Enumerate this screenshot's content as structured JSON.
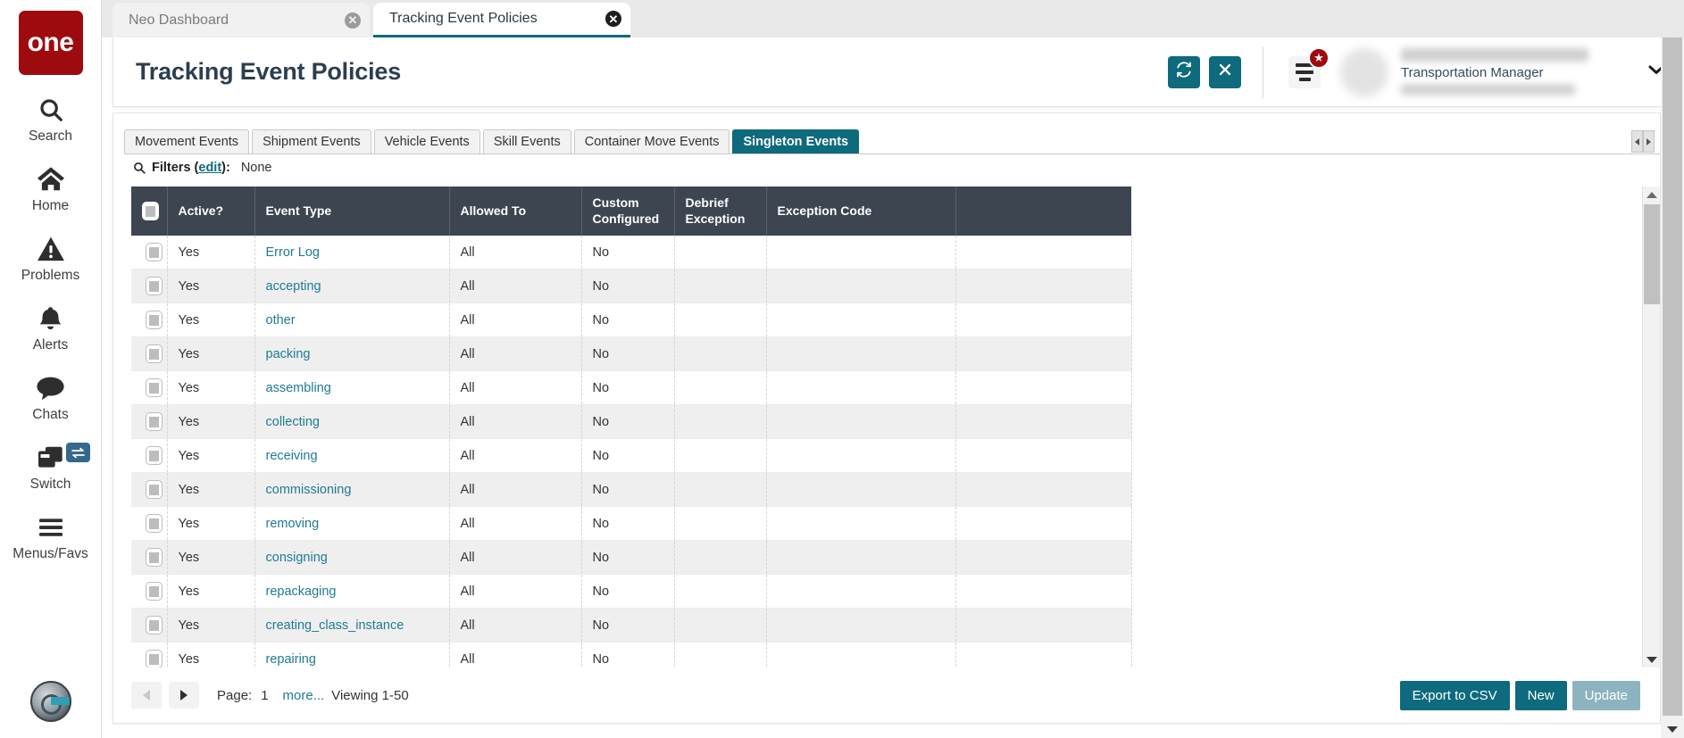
{
  "sidebar": {
    "logo_text": "one",
    "items": [
      {
        "label": "Search",
        "icon": "search-icon"
      },
      {
        "label": "Home",
        "icon": "home-icon"
      },
      {
        "label": "Problems",
        "icon": "warning-triangle-icon"
      },
      {
        "label": "Alerts",
        "icon": "bell-icon"
      },
      {
        "label": "Chats",
        "icon": "chat-bubble-icon"
      },
      {
        "label": "Switch",
        "icon": "windows-stack-icon"
      },
      {
        "label": "Menus/Favs",
        "icon": "hamburger-icon"
      }
    ],
    "switch_badge_icon": "swap-arrows-icon",
    "avatar_icon": "robot-head-avatar"
  },
  "browser_tabs": [
    {
      "label": "Neo Dashboard",
      "active": false,
      "close_icon": "close-circle-icon"
    },
    {
      "label": "Tracking Event Policies",
      "active": true,
      "close_icon": "close-circle-icon"
    }
  ],
  "header": {
    "title": "Tracking Event Policies",
    "refresh_icon": "refresh-icon",
    "close_icon": "x-icon",
    "menu_icon": "list-menu-icon",
    "star_badge_icon": "star-icon",
    "chevron_icon": "chevron-down-icon",
    "profile": {
      "role": "Transportation Manager",
      "name_redacted": true,
      "org_redacted": true
    }
  },
  "panel": {
    "tabs": [
      {
        "label": "Movement Events",
        "active": false
      },
      {
        "label": "Shipment Events",
        "active": false
      },
      {
        "label": "Vehicle Events",
        "active": false
      },
      {
        "label": "Skill Events",
        "active": false
      },
      {
        "label": "Container Move Events",
        "active": false
      },
      {
        "label": "Singleton Events",
        "active": true
      }
    ],
    "tab_nav": {
      "left_icon": "arrow-left-icon",
      "right_icon": "arrow-right-icon"
    },
    "filters": {
      "icon": "search-icon",
      "label": "Filters (",
      "edit_label": "edit",
      "label_end": "):",
      "value": "None"
    }
  },
  "table": {
    "select_all_icon": "checkbox-icon",
    "columns": [
      "",
      "Active?",
      "Event Type",
      "Allowed To",
      "Custom Configured",
      "Debrief Exception",
      "Exception Code",
      ""
    ],
    "rows": [
      {
        "active": "Yes",
        "event_type": "Error Log",
        "allowed_to": "All",
        "custom_configured": "No",
        "debrief_exception": "",
        "exception_code": ""
      },
      {
        "active": "Yes",
        "event_type": "accepting",
        "allowed_to": "All",
        "custom_configured": "No",
        "debrief_exception": "",
        "exception_code": ""
      },
      {
        "active": "Yes",
        "event_type": "other",
        "allowed_to": "All",
        "custom_configured": "No",
        "debrief_exception": "",
        "exception_code": ""
      },
      {
        "active": "Yes",
        "event_type": "packing",
        "allowed_to": "All",
        "custom_configured": "No",
        "debrief_exception": "",
        "exception_code": ""
      },
      {
        "active": "Yes",
        "event_type": "assembling",
        "allowed_to": "All",
        "custom_configured": "No",
        "debrief_exception": "",
        "exception_code": ""
      },
      {
        "active": "Yes",
        "event_type": "collecting",
        "allowed_to": "All",
        "custom_configured": "No",
        "debrief_exception": "",
        "exception_code": ""
      },
      {
        "active": "Yes",
        "event_type": "receiving",
        "allowed_to": "All",
        "custom_configured": "No",
        "debrief_exception": "",
        "exception_code": ""
      },
      {
        "active": "Yes",
        "event_type": "commissioning",
        "allowed_to": "All",
        "custom_configured": "No",
        "debrief_exception": "",
        "exception_code": ""
      },
      {
        "active": "Yes",
        "event_type": "removing",
        "allowed_to": "All",
        "custom_configured": "No",
        "debrief_exception": "",
        "exception_code": ""
      },
      {
        "active": "Yes",
        "event_type": "consigning",
        "allowed_to": "All",
        "custom_configured": "No",
        "debrief_exception": "",
        "exception_code": ""
      },
      {
        "active": "Yes",
        "event_type": "repackaging",
        "allowed_to": "All",
        "custom_configured": "No",
        "debrief_exception": "",
        "exception_code": ""
      },
      {
        "active": "Yes",
        "event_type": "creating_class_instance",
        "allowed_to": "All",
        "custom_configured": "No",
        "debrief_exception": "",
        "exception_code": ""
      },
      {
        "active": "Yes",
        "event_type": "repairing",
        "allowed_to": "All",
        "custom_configured": "No",
        "debrief_exception": "",
        "exception_code": ""
      }
    ]
  },
  "footer": {
    "prev_icon": "chevron-left-icon",
    "next_icon": "chevron-right-icon",
    "page_label": "Page:",
    "page_number": "1",
    "more_label": "more...",
    "viewing_label": "Viewing 1-50",
    "export_label": "Export to CSV",
    "new_label": "New",
    "update_label": "Update"
  },
  "colors": {
    "brand_red": "#9e0b0f",
    "accent_teal": "#0e6a7d",
    "header_dark": "#3d4551",
    "link_blue": "#1f7a94",
    "muted_teal": "#8cb4bf"
  }
}
